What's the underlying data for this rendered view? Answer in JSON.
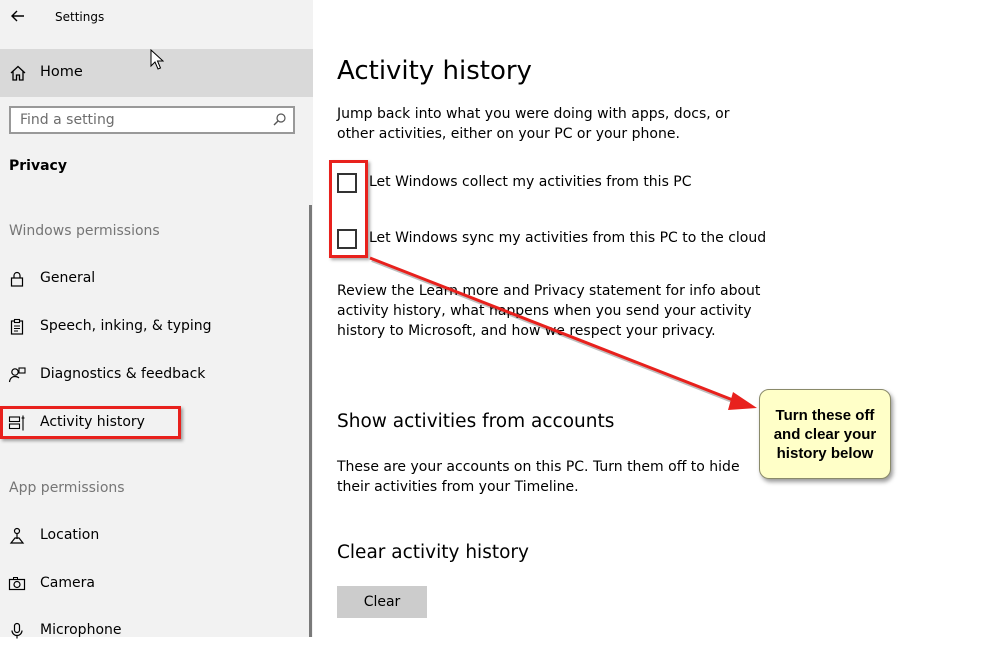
{
  "window": {
    "title": "Settings"
  },
  "sidebar": {
    "home_label": "Home",
    "search": {
      "placeholder": "Find a setting",
      "value": ""
    },
    "section_title": "Privacy",
    "groups": [
      {
        "label": "Windows permissions"
      },
      {
        "label": "App permissions"
      }
    ],
    "items": [
      {
        "label": "General",
        "icon": "lock-icon"
      },
      {
        "label": "Speech, inking, & typing",
        "icon": "clipboard-icon"
      },
      {
        "label": "Diagnostics & feedback",
        "icon": "person-feedback-icon"
      },
      {
        "label": "Activity history",
        "icon": "timeline-icon",
        "selected": true
      },
      {
        "label": "Location",
        "icon": "location-icon"
      },
      {
        "label": "Camera",
        "icon": "camera-icon"
      },
      {
        "label": "Microphone",
        "icon": "microphone-icon"
      }
    ]
  },
  "main": {
    "title": "Activity history",
    "intro": "Jump back into what you were doing with apps, docs, or other activities, either on your PC or your phone.",
    "checkboxes": [
      {
        "label": "Let Windows collect my activities from this PC",
        "checked": false
      },
      {
        "label": "Let Windows sync my activities from this PC to the cloud",
        "checked": false
      }
    ],
    "privacy_text": "Review the Learn more and Privacy statement for info about activity history, what happens when you send your activity history to Microsoft, and how we respect your privacy.",
    "accounts_heading": "Show activities from accounts",
    "accounts_text": "These are your accounts on this PC. Turn them off to hide their activities from your Timeline.",
    "clear_heading": "Clear activity history",
    "clear_button": "Clear"
  },
  "annotation": {
    "callout_text": "Turn these off\nand clear your\nhistory below",
    "highlight_color": "#e8211d",
    "callout_bg": "#ffffc8"
  }
}
